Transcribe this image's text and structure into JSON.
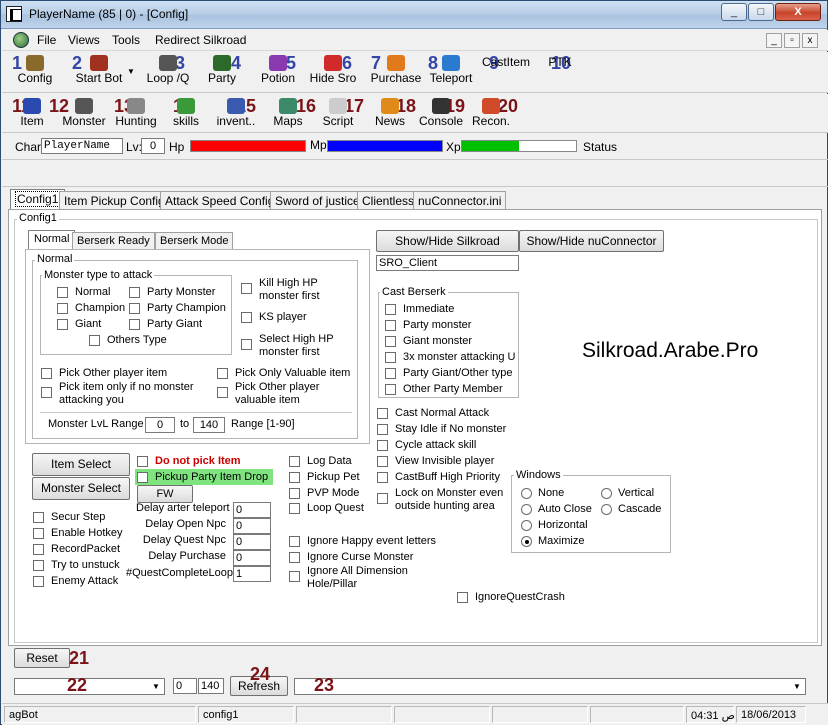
{
  "window": {
    "title": "PlayerName (85 | 0)  - [Config]",
    "minimize": "_",
    "maximize": "□",
    "close": "X"
  },
  "menu": {
    "items": [
      "File",
      "Views",
      "Tools",
      "Redirect Silkroad"
    ],
    "mdi_min": "_",
    "mdi_restore": "▫",
    "mdi_close": "x"
  },
  "toolbar1": [
    {
      "num": "1",
      "label": "Config",
      "icon": "config-icon",
      "color": "#8a6a2a"
    },
    {
      "num": "2",
      "label": "Start Bot",
      "icon": "bug-icon",
      "color": "#a03020"
    },
    {
      "num": "3",
      "label": "Loop /Q",
      "icon": "loop-icon",
      "color": "#555555"
    },
    {
      "num": "4",
      "label": "Party",
      "icon": "party-icon",
      "color": "#2c6a2c"
    },
    {
      "num": "5",
      "label": "Potion",
      "icon": "potion-icon",
      "color": "#8a3ab0"
    },
    {
      "num": "6",
      "label": "Hide Sro",
      "icon": "hide-icon",
      "color": "#d02a2a"
    },
    {
      "num": "7",
      "label": "Purchase",
      "icon": "purchase-icon",
      "color": "#e07a1a"
    },
    {
      "num": "8",
      "label": "Teleport",
      "icon": "teleport-icon",
      "color": "#2a7ad0"
    },
    {
      "num": "9",
      "label": "CastItem",
      "icon": "",
      "color": ""
    },
    {
      "num": "10",
      "label": "PTK",
      "icon": "",
      "color": ""
    }
  ],
  "toolbar2": [
    {
      "num": "11",
      "label": "Item",
      "icon": "item-icon",
      "color": "#2a4ab0"
    },
    {
      "num": "12",
      "label": "Monster",
      "icon": "monster-icon",
      "color": "#555555"
    },
    {
      "num": "13",
      "label": "Hunting",
      "icon": "hunting-icon",
      "color": "#888888"
    },
    {
      "num": "14",
      "label": "skills",
      "icon": "skills-icon",
      "color": "#3a9a3a"
    },
    {
      "num": "15",
      "label": "invent..",
      "icon": "inventory-icon",
      "color": "#3a5ab0"
    },
    {
      "num": "16",
      "label": "Maps",
      "icon": "maps-icon",
      "color": "#3a8a6a"
    },
    {
      "num": "17",
      "label": "Script",
      "icon": "script-icon",
      "color": "#cccccc"
    },
    {
      "num": "18",
      "label": "News",
      "icon": "news-icon",
      "color": "#e08a1a"
    },
    {
      "num": "19",
      "label": "Console",
      "icon": "console-icon",
      "color": "#333333"
    },
    {
      "num": "20",
      "label": "Recon.",
      "icon": "recon-icon",
      "color": "#d04a2a"
    }
  ],
  "char": {
    "char_label": "Char:",
    "char_value": "PlayerName",
    "lv_label": "Lv:",
    "lv_value": "0",
    "hp_label": "Hp",
    "mp_label": "Mp",
    "xp_label": "Xp",
    "xp_level": 0.5,
    "status_label": "Status",
    "hp_color": "#ff0000",
    "mp_color": "#0000ff",
    "xp_color": "#00c000"
  },
  "main_tabs": [
    "Config1",
    "Item Pickup Config",
    "Attack Speed Config",
    "Sword of justice",
    "Clientless",
    "nuConnector.ini"
  ],
  "config1": {
    "title": "Config1",
    "subtabs": [
      "Normal",
      "Berserk Ready",
      "Berserk Mode"
    ],
    "normal_group": "Normal",
    "monster_type_group": "Monster type to attack",
    "monster_types": [
      "Normal",
      "Party Monster",
      "Champion",
      "Party Champion",
      "Giant",
      "Party Giant",
      "Others Type"
    ],
    "right_checks": [
      "Kill High HP monster first",
      "KS player",
      "Select High HP monster first"
    ],
    "pick_checks": [
      "Pick Other player item",
      "Pick Only Valuable item",
      "Pick item only if no monster attacking you",
      "Pick Other player valuable item"
    ],
    "lvl_range_label": "Monster LvL Range",
    "lvl_from": "0",
    "lvl_to_label": "to",
    "lvl_to": "140",
    "range_hint": "Range [1-90]"
  },
  "silkroad": {
    "show_hide_silkroad": "Show/Hide Silkroad",
    "show_hide_nuconnector": "Show/Hide nuConnector",
    "client_name": "SRO_Client",
    "watermark": "Silkroad.Arabe.Pro"
  },
  "cast_berserk": {
    "title": "Cast Berserk",
    "items": [
      "Immediate",
      "Party monster",
      "Giant monster",
      "3x monster attacking U",
      "Party Giant/Other type",
      "Other Party Member"
    ]
  },
  "attack_checks": [
    "Cast Normal Attack",
    "Stay Idle if No monster",
    "Cycle attack skill",
    "View Invisible player",
    "CastBuff High Priority",
    "Lock on Monster even outside hunting area"
  ],
  "windows_group": {
    "title": "Windows",
    "options": [
      "None",
      "Vertical",
      "Auto Close",
      "Cascade",
      "Horizontal",
      "Maximize"
    ],
    "selected": "Maximize"
  },
  "buttons": {
    "item_select": "Item Select",
    "monster_select": "Monster Select",
    "fw": "FW",
    "reset": "Reset",
    "refresh": "Refresh"
  },
  "pick_item": {
    "do_not_pick": "Do not pick Item",
    "pickup_party": "Pickup Party Item Drop"
  },
  "misc_checks": [
    "Log Data",
    "Pickup Pet",
    "PVP Mode",
    "Loop Quest"
  ],
  "left_checks": [
    "Secur Step",
    "Enable Hotkey",
    "RecordPacket",
    "Try to unstuck",
    "Enemy Attack"
  ],
  "delays": [
    {
      "label": "Delay arter teleport",
      "value": "0"
    },
    {
      "label": "Delay Open Npc",
      "value": "0"
    },
    {
      "label": "Delay Quest Npc",
      "value": "0"
    },
    {
      "label": "Delay Purchase",
      "value": "0"
    },
    {
      "label": "#QuestCompleteLoop",
      "value": "1"
    }
  ],
  "ignore_checks": [
    "Ignore Happy event letters",
    "Ignore Curse Monster",
    "Ignore All Dimension Hole/Pillar"
  ],
  "ignore_quest_crash": "IgnoreQuestCrash",
  "annotations": {
    "n21": "21",
    "n22": "22",
    "n23": "23",
    "n24": "24"
  },
  "bottom": {
    "field1": "0",
    "field2": "140"
  },
  "status": {
    "app": "agBot",
    "tab": "config1",
    "time": "04:31 ص",
    "date": "18/06/2013"
  }
}
